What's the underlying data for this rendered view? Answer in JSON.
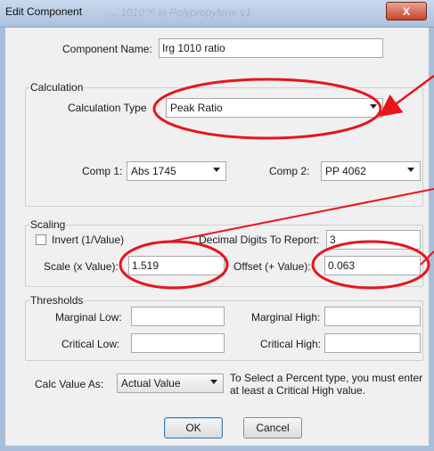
{
  "window": {
    "title": "Edit Component",
    "ghost_title": "... 1010™ in Polypropylene v1",
    "close_glyph": "X"
  },
  "component_name": {
    "label": "Component Name:",
    "value": "Irg 1010 ratio"
  },
  "calculation": {
    "group_title": "Calculation",
    "type_label": "Calculation Type",
    "type_value": "Peak Ratio",
    "comp1_label": "Comp 1:",
    "comp1_value": "Abs 1745",
    "comp2_label": "Comp 2:",
    "comp2_value": "PP 4062"
  },
  "scaling": {
    "group_title": "Scaling",
    "invert_label": "Invert (1/Value)",
    "invert_checked": false,
    "decimal_label": "Decimal Digits To Report:",
    "decimal_value": "3",
    "scale_label": "Scale (x Value):",
    "scale_value": "1.519",
    "offset_label": "Offset (+ Value):",
    "offset_value": "0.063"
  },
  "thresholds": {
    "group_title": "Thresholds",
    "marginal_low_label": "Marginal Low:",
    "marginal_low_value": "",
    "marginal_high_label": "Marginal High:",
    "marginal_high_value": "",
    "critical_low_label": "Critical Low:",
    "critical_low_value": "",
    "critical_high_label": "Critical High:",
    "critical_high_value": ""
  },
  "calc_value": {
    "label": "Calc Value As:",
    "value": "Actual Value",
    "note_line1": "To Select a Percent type, you must enter",
    "note_line2": "at least a Critical High value."
  },
  "buttons": {
    "ok": "OK",
    "cancel": "Cancel"
  },
  "annotation_color": "#e8141a"
}
